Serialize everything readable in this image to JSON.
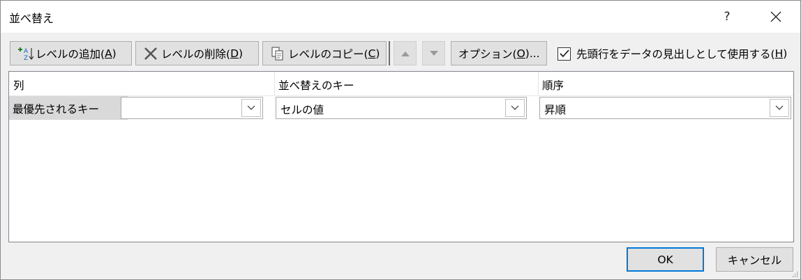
{
  "dialog": {
    "title": "並べ替え",
    "help_label": "?"
  },
  "toolbar": {
    "add_level": {
      "label": "レベルの追加(",
      "accel": "A",
      "tail": ")"
    },
    "delete_level": {
      "label": "レベルの削除(",
      "accel": "D",
      "tail": ")"
    },
    "copy_level": {
      "label": "レベルのコピー(",
      "accel": "C",
      "tail": ")"
    },
    "options": {
      "label": "オプション(",
      "accel": "O",
      "tail": ")..."
    },
    "header_checkbox": {
      "label": "先頭行をデータの見出しとして使用する(",
      "accel": "H",
      "tail": ")",
      "checked": true
    }
  },
  "grid": {
    "columns": [
      "列",
      "並べ替えのキー",
      "順序"
    ],
    "rows": [
      {
        "label": "最優先されるキー",
        "column_value": "",
        "sort_on": "セルの値",
        "order": "昇順"
      }
    ]
  },
  "buttons": {
    "ok": "OK",
    "cancel": "キャンセル"
  },
  "colors": {
    "accent": "#0078d7",
    "dialog_bg": "#f0f0f0",
    "button_bg": "#e1e1e1"
  }
}
